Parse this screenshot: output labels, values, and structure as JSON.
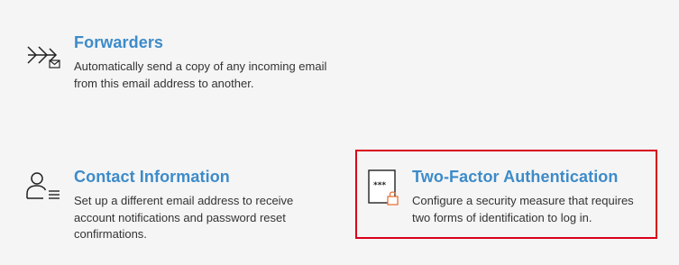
{
  "items": [
    {
      "title": "Forwarders",
      "description": "Automatically send a copy of any incoming email from this email address to another.",
      "icon": "forward-mail-icon"
    },
    {
      "title": "Contact Information",
      "description": "Set up a different email address to receive account notifications and password reset confirmations.",
      "icon": "contact-person-icon"
    },
    {
      "title": "Two-Factor Authentication",
      "description": "Configure a security measure that requires two forms of identification to log in.",
      "icon": "two-factor-lock-icon",
      "highlighted": true
    }
  ],
  "colors": {
    "title": "#3d8bc9",
    "text": "#333333",
    "highlight_border": "#d9001b",
    "accent_lock": "#e8743b",
    "background": "#f5f5f5"
  }
}
